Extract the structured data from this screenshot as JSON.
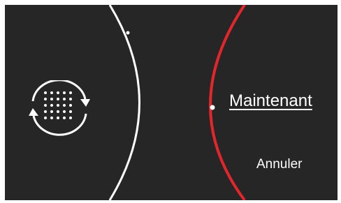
{
  "dialog": {
    "now_label": "Maintenant",
    "cancel_label": "Annuler",
    "icon": "sync-icon"
  },
  "colors": {
    "background": "#262626",
    "left_arc": "#ffffff",
    "right_arc": "#e3262c",
    "text": "#ffffff"
  }
}
